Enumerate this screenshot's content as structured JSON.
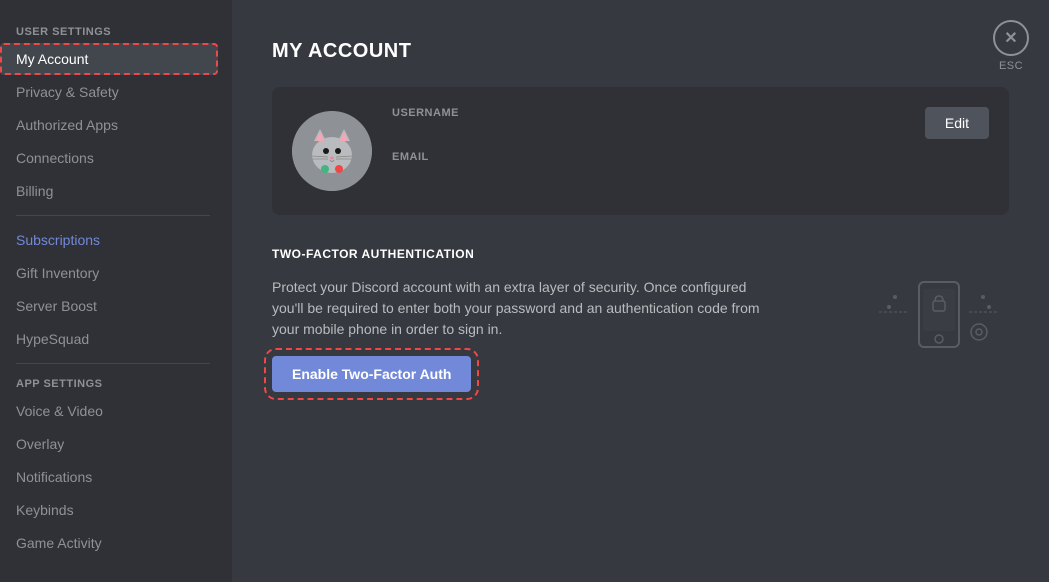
{
  "sidebar": {
    "user_settings_label": "USER SETTINGS",
    "app_settings_label": "APP SETTINGS",
    "items": {
      "my_account": "My Account",
      "privacy_safety": "Privacy & Safety",
      "authorized_apps": "Authorized Apps",
      "connections": "Connections",
      "billing": "Billing",
      "subscriptions": "Subscriptions",
      "gift_inventory": "Gift Inventory",
      "server_boost": "Server Boost",
      "hype_squad": "HypeSquad",
      "voice_video": "Voice & Video",
      "overlay": "Overlay",
      "notifications": "Notifications",
      "keybinds": "Keybinds",
      "game_activity": "Game Activity"
    }
  },
  "main": {
    "page_title": "MY ACCOUNT",
    "account": {
      "username_label": "USERNAME",
      "email_label": "EMAIL",
      "username_value": "",
      "email_value": "",
      "edit_button": "Edit"
    },
    "tfa": {
      "title": "TWO-FACTOR AUTHENTICATION",
      "description": "Protect your Discord account with an extra layer of security. Once configured you'll be required to enter both your password and an authentication code from your mobile phone in order to sign in.",
      "enable_button": "Enable Two-Factor Auth"
    },
    "esc": {
      "label": "ESC",
      "icon": "✕"
    }
  },
  "colors": {
    "accent": "#7289da",
    "danger": "#f04747",
    "sidebar_bg": "#2f3136",
    "main_bg": "#36393f",
    "card_bg": "#2f3136"
  }
}
